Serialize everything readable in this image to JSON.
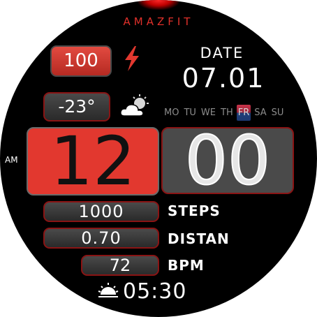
{
  "brand": "AMAZFIT",
  "battery": {
    "value": "100"
  },
  "weather": {
    "temperature": "-23°",
    "icon": "partly-cloudy-icon"
  },
  "date": {
    "label": "DATE",
    "value": "07.01"
  },
  "weekdays": [
    {
      "label": "MO",
      "active": false
    },
    {
      "label": "TU",
      "active": false
    },
    {
      "label": "WE",
      "active": false
    },
    {
      "label": "TH",
      "active": false
    },
    {
      "label": "FR",
      "active": true
    },
    {
      "label": "SA",
      "active": false
    },
    {
      "label": "SU",
      "active": false
    }
  ],
  "time": {
    "ampm": "AM",
    "hour": "12",
    "minute": "00"
  },
  "metrics": {
    "steps": {
      "value": "1000",
      "label": "STEPS"
    },
    "distance": {
      "value": "0.70",
      "label": "DISTAN"
    },
    "heart": {
      "value": "72",
      "label": "BPM"
    }
  },
  "sunrise": {
    "time": "05:30",
    "icon": "sunrise-icon"
  },
  "colors": {
    "accent": "#e2382f",
    "background": "#000000",
    "panel": "#4a4a4a"
  }
}
